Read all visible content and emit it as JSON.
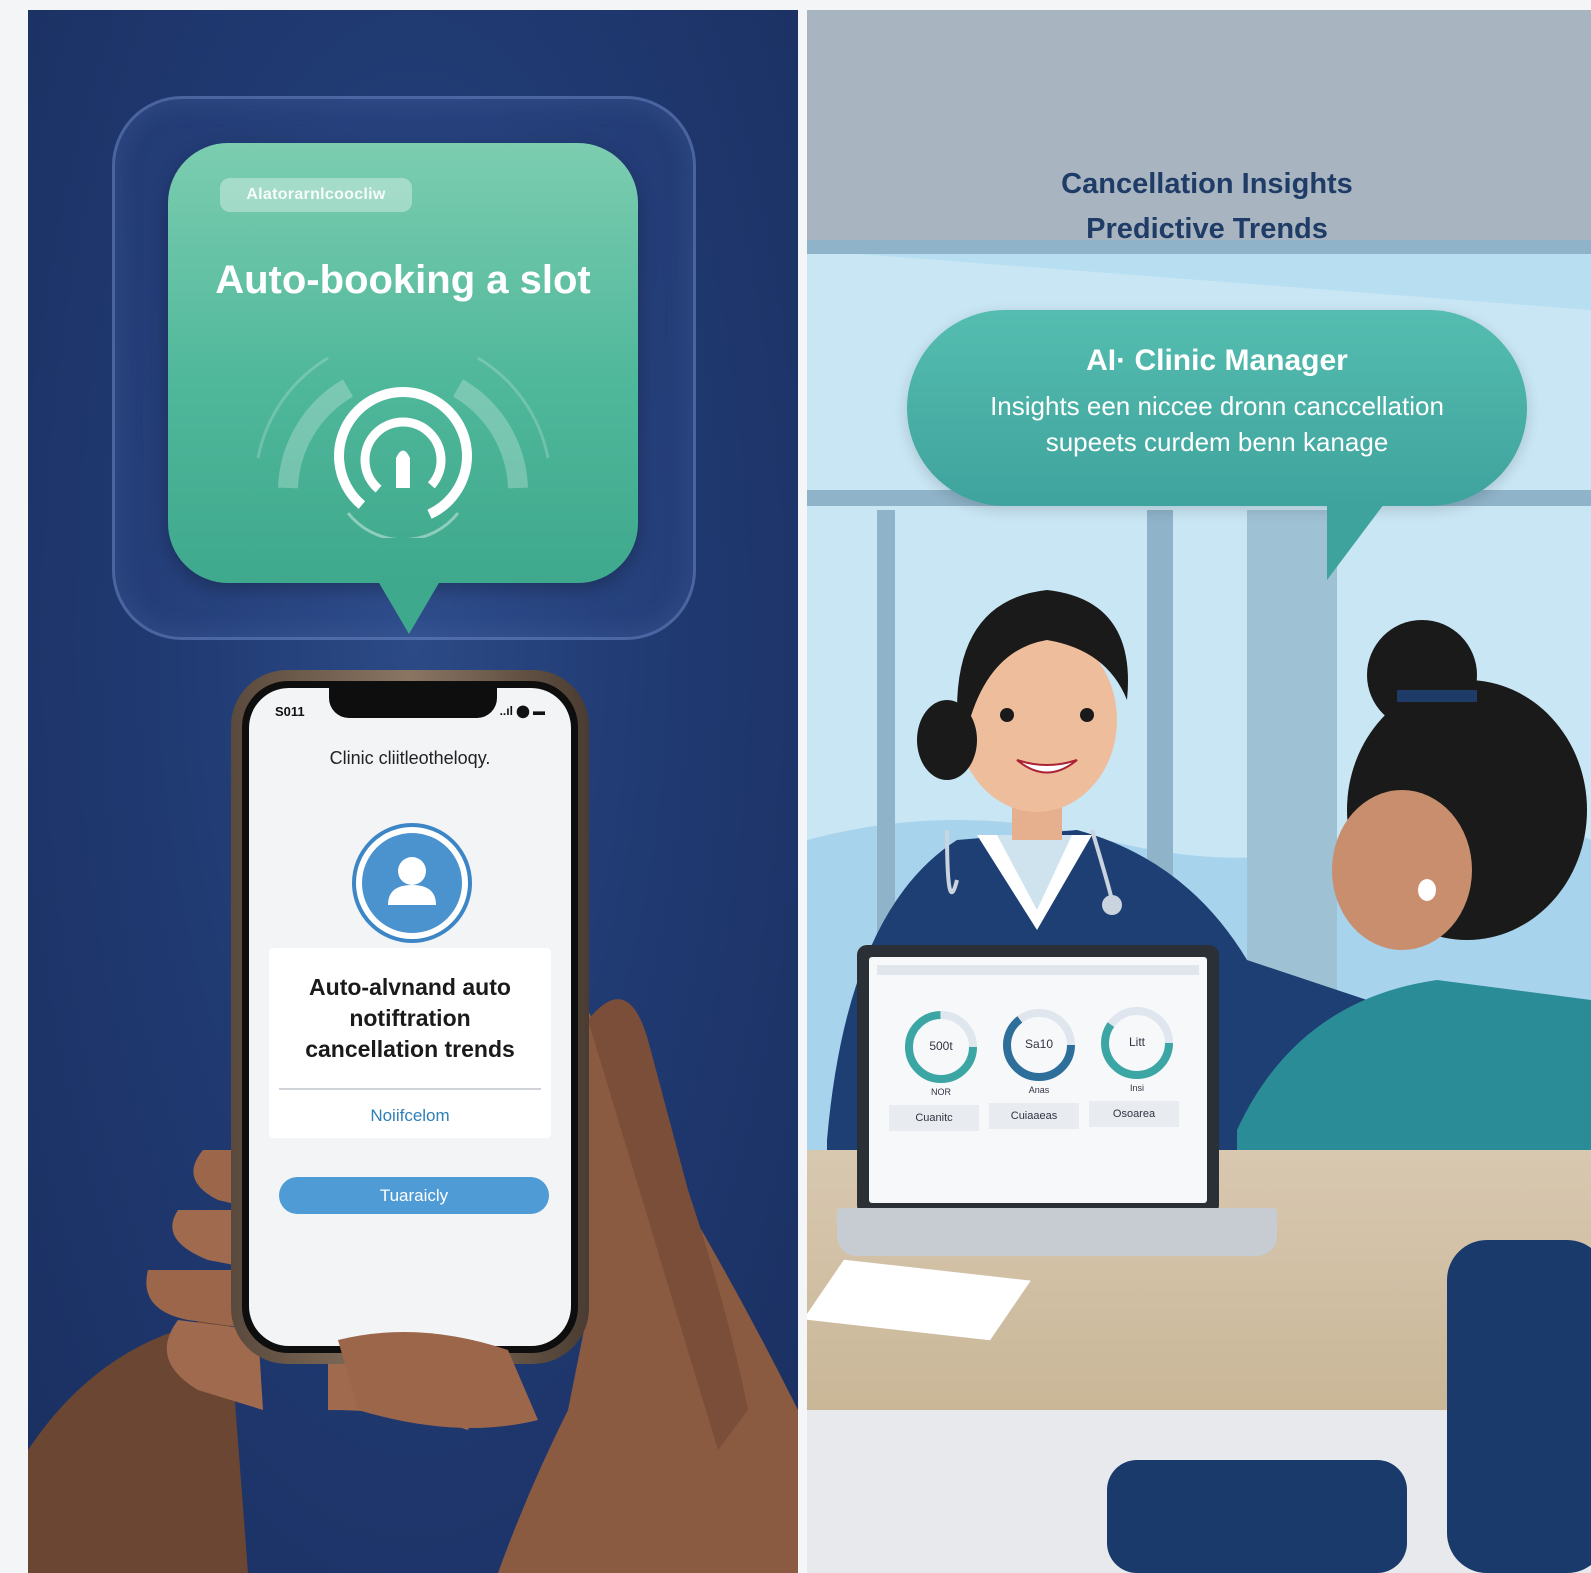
{
  "left_panel": {
    "bubble": {
      "chip_label": "Alatorarnlcoocliw",
      "title": "Auto-booking a slot",
      "icon": "notification-bell-icon"
    },
    "phone": {
      "status_time": "S011",
      "status_icons": "..ıl ⬤ ▬",
      "app_header": "Clinic cliitleotheloqy.",
      "avatar_icon": "user-icon",
      "card_text_line1": "Auto-alvnand auto",
      "card_text_line2": "notiftration",
      "card_text_line3": "cancellation trends",
      "card_link": "Noiifcelom",
      "button_label": "Tuaraicly"
    }
  },
  "right_panel": {
    "header_line1": "Cancellation Insights",
    "header_line2": "Predictive Trends",
    "ai_bubble": {
      "title": "AI· Clinic Manager",
      "line1": "Insights een niccee dronn canccellation",
      "line2": "supeets curdem benn kanage"
    },
    "laptop": {
      "gauges": [
        {
          "value": "500t",
          "sub": "NOR",
          "tab": "Cuanitc"
        },
        {
          "value": "Sa10",
          "sub": "Anas",
          "tab": "Cuiaaeas"
        },
        {
          "value": "Litt",
          "sub": "Insi",
          "tab": "Osoarea"
        }
      ]
    }
  },
  "colors": {
    "left_bg": "#203a72",
    "bubble_teal": "#4fb79a",
    "ai_bubble_teal": "#3fa39d",
    "header_navy": "#1f3c66",
    "button_blue": "#4e9bd6"
  }
}
